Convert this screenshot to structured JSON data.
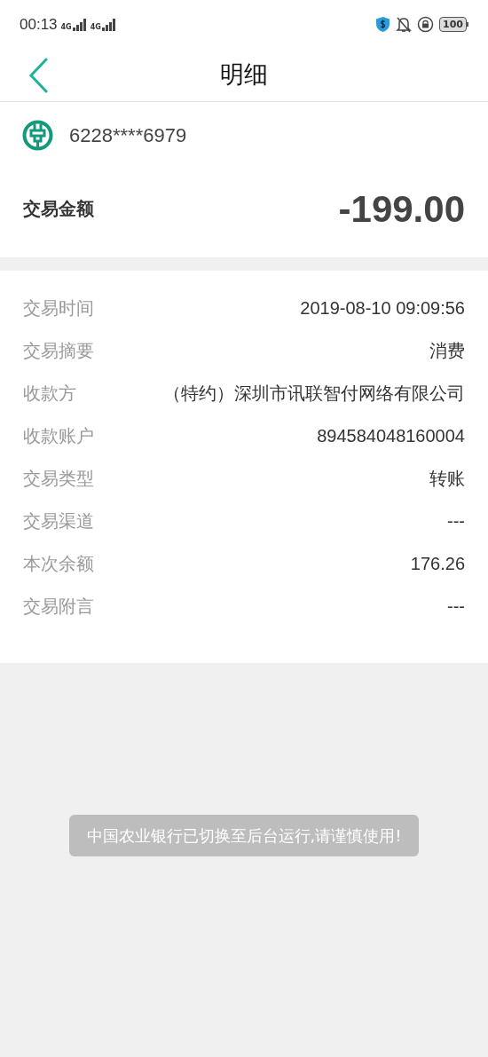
{
  "status_bar": {
    "time": "00:13",
    "sim_1": "4G",
    "sim_2": "4G",
    "battery": "100"
  },
  "header": {
    "title": "明细"
  },
  "account": {
    "number": "6228****6979"
  },
  "amount": {
    "label": "交易金额",
    "value": "-199.00"
  },
  "details": [
    {
      "label": "交易时间",
      "value": "2019-08-10 09:09:56"
    },
    {
      "label": "交易摘要",
      "value": "消费"
    },
    {
      "label": "收款方",
      "value": "（特约）深圳市讯联智付网络有限公司"
    },
    {
      "label": "收款账户",
      "value": "894584048160004"
    },
    {
      "label": "交易类型",
      "value": "转账"
    },
    {
      "label": "交易渠道",
      "value": "---"
    },
    {
      "label": "本次余额",
      "value": "176.26"
    },
    {
      "label": "交易附言",
      "value": "---"
    }
  ],
  "toast": {
    "text": "中国农业银行已切换至后台运行,请谨慎使用!"
  }
}
